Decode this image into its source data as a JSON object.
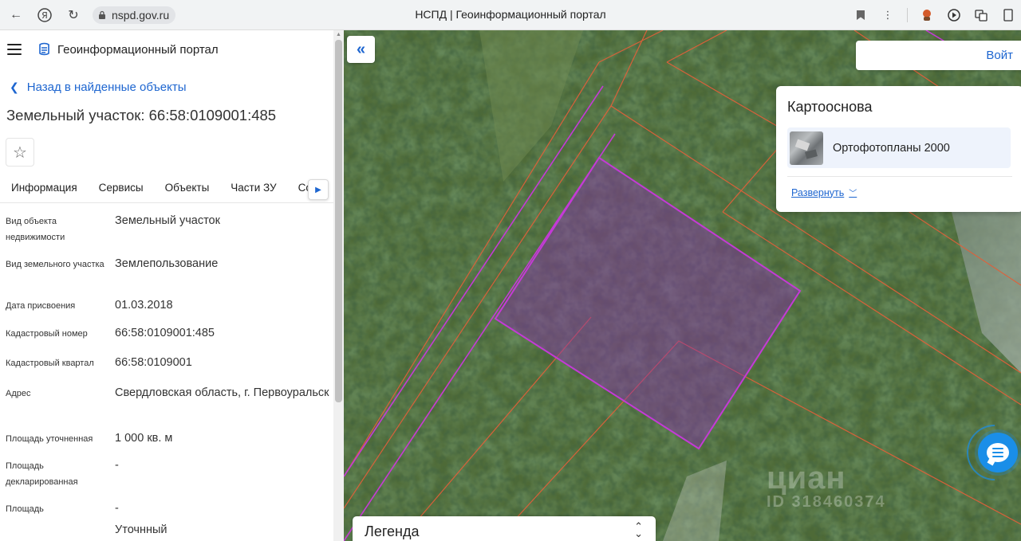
{
  "browser": {
    "url": "nspd.gov.ru",
    "tab_title": "НСПД | Геоинформационный портал"
  },
  "header": {
    "app_title": "Геоинформационный портал"
  },
  "nav": {
    "back_label": "Назад в найденные объекты"
  },
  "object": {
    "title": "Земельный участок: 66:58:0109001:485"
  },
  "tabs": [
    {
      "label": "Информация",
      "active": true
    },
    {
      "label": "Сервисы"
    },
    {
      "label": "Объекты"
    },
    {
      "label": "Части ЗУ"
    },
    {
      "label": "Сост"
    }
  ],
  "info_rows": [
    {
      "label": "Вид объекта недвижимости",
      "value": "Земельный участок"
    },
    {
      "label": "Вид земельного участка",
      "value": "Землепользование"
    },
    {
      "label": "Дата присвоения",
      "value": "01.03.2018"
    },
    {
      "label": "Кадастровый номер",
      "value": "66:58:0109001:485"
    },
    {
      "label": "Кадастровый квартал",
      "value": "66:58:0109001"
    },
    {
      "label": "Адрес",
      "value": "Свердловская область, г. Первоуральск"
    },
    {
      "label": "Площадь уточненная",
      "value": "1 000 кв. м"
    },
    {
      "label": "Площадь декларированная",
      "value": "-"
    },
    {
      "label": "Площадь",
      "value": "-"
    },
    {
      "label": "",
      "value": "Уточнный"
    }
  ],
  "map": {
    "search_button_label": "Войт",
    "basemap_panel": {
      "title": "Картооснова",
      "selected_layer": "Ортофотопланы 2000",
      "expand_label": "Развернуть"
    },
    "legend_title": "Легенда",
    "watermark_text": "циан",
    "watermark_id": "ID 318460374"
  },
  "colors": {
    "accent": "#1e66d0",
    "parcel_outline": "#c43ad6",
    "cadastral_lines": "#e0603a",
    "chat_button": "#1a8ee8"
  }
}
